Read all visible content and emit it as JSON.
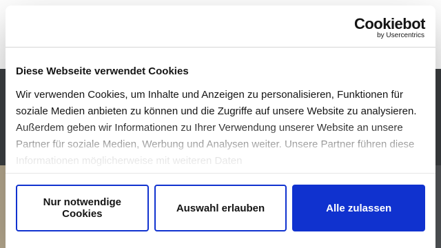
{
  "brand": {
    "logo_text": "Cookiebot",
    "logo_subtext": "by Usercentrics"
  },
  "dialog": {
    "title": "Diese Webseite verwendet Cookies",
    "body": "Wir verwenden Cookies, um Inhalte und Anzeigen zu personalisieren, Funktionen für soziale Medien anbieten zu können und die Zugriffe auf unsere Website zu analysieren. Außerdem geben wir Informationen zu Ihrer Verwendung unserer Website an unsere Partner für soziale Medien, Werbung und Analysen weiter. Unsere Partner führen diese Informationen möglicherweise mit weiteren Daten"
  },
  "buttons": {
    "necessary_label": "Nur notwendige Cookies",
    "selection_label": "Auswahl erlauben",
    "accept_all_label": "Alle zulassen"
  },
  "colors": {
    "accent": "#1032cf",
    "text": "#141414"
  }
}
